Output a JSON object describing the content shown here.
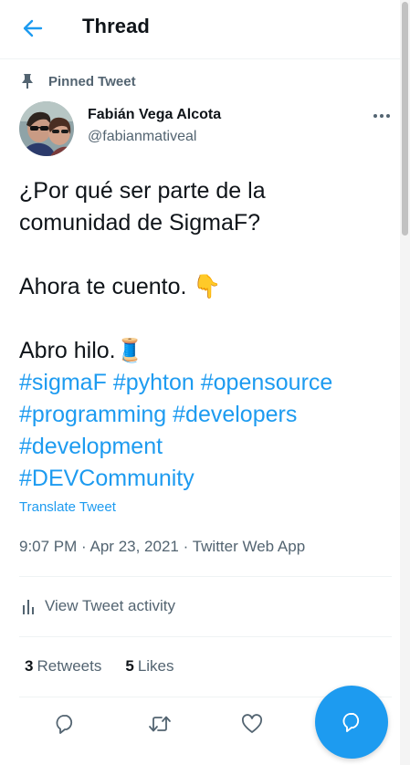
{
  "colors": {
    "accent": "#1d9bf0",
    "muted": "#536471",
    "text": "#0f1419"
  },
  "header": {
    "title": "Thread",
    "back_icon": "arrow-left-icon"
  },
  "pinned": {
    "label": "Pinned Tweet",
    "icon": "pin-icon"
  },
  "author": {
    "name": "Fabián Vega Alcota",
    "handle": "@fabianmativeal",
    "more_icon": "more-horizontal-icon"
  },
  "tweet": {
    "lines": [
      "¿Por qué ser parte de la",
      "comunidad de SigmaF?",
      "Ahora te cuento. 👇",
      "Abro hilo.🧵"
    ],
    "hashtags": {
      "line1": [
        "#sigmaF",
        "#pyhton",
        "#opensource"
      ],
      "line2": [
        "#programming",
        "#developers"
      ],
      "line3": [
        "#development"
      ],
      "line4": [
        "#DEVCommunity"
      ]
    },
    "translate": "Translate Tweet"
  },
  "meta": {
    "time": "9:07 PM",
    "sep": "·",
    "date": "Apr 23, 2021",
    "source": "Twitter Web App"
  },
  "activity": {
    "label": "View Tweet activity",
    "icon": "bar-chart-icon"
  },
  "stats": {
    "retweets_count": "3",
    "retweets_label": "Retweets",
    "likes_count": "5",
    "likes_label": "Likes"
  },
  "actions": {
    "reply_icon": "reply-icon",
    "retweet_icon": "retweet-icon",
    "like_icon": "heart-icon"
  },
  "fab": {
    "icon": "compose-reply-icon"
  }
}
